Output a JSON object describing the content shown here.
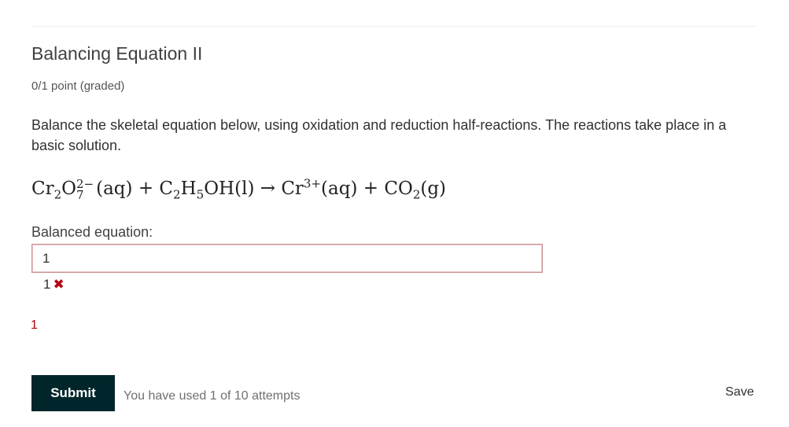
{
  "problem": {
    "title": "Balancing Equation II",
    "points": "0/1 point (graded)",
    "prompt": "Balance the skeletal equation below, using oxidation and reduction half-reactions. The reactions take place in a basic solution.",
    "equation": {
      "r1_base1": "Cr",
      "r1_sub1": "2",
      "r1_base2": "O",
      "r1_sup": "2−",
      "r1_sub2": "7",
      "r1_state": "(aq)",
      "plus1": "+",
      "r2_base1": "C",
      "r2_sub1": "2",
      "r2_base2": "H",
      "r2_sub2": "5",
      "r2_base3": "OH",
      "r2_state": "(l)",
      "arrow": "→",
      "p1_base": "Cr",
      "p1_sup": "3+",
      "p1_state": "(aq)",
      "plus2": "+",
      "p2_base": "CO",
      "p2_sub": "2",
      "p2_state": "(g)"
    },
    "input_label": "Balanced equation:",
    "input_value": "1",
    "preview_value": "1",
    "status_icon": "incorrect-x-icon",
    "feedback": "1",
    "error_color": "#b20610"
  },
  "actions": {
    "submit_label": "Submit",
    "attempts_text": "You have used 1 of 10 attempts",
    "save_label": "Save",
    "submit_color": "#00262b"
  }
}
